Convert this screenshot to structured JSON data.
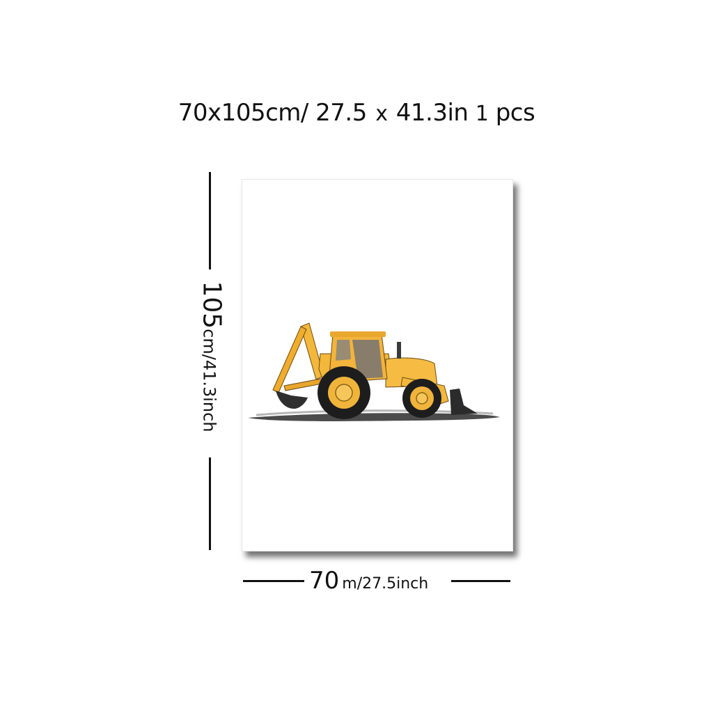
{
  "title": {
    "size_cm": "70x105cm/",
    "size_in_w": "27.5",
    "times": "x",
    "size_in_h": "41.3in",
    "qty_num": "1",
    "qty_unit": "pcs"
  },
  "height_label": {
    "value": "105",
    "unit": "cm/41.3inch"
  },
  "width_label": {
    "value": "70",
    "unit": "m/27.5inch"
  },
  "artwork": {
    "subject": "backhoe-loader-watercolor",
    "body_color": "#f3b73c",
    "shadow_color": "#2c2c2c",
    "tire_color": "#1d1d1d"
  }
}
